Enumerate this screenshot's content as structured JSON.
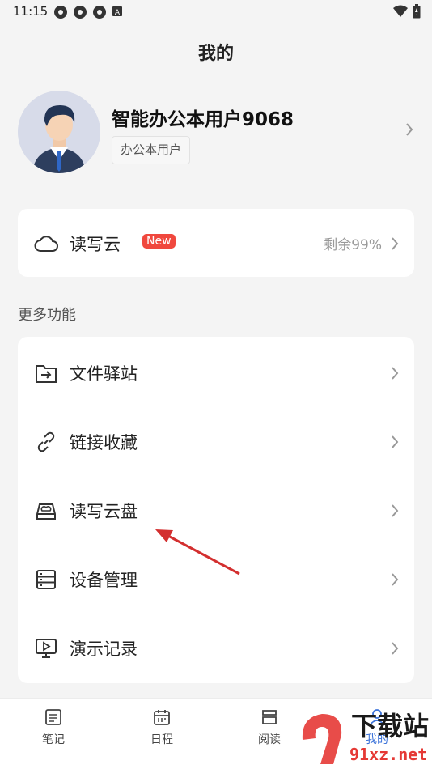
{
  "status_bar": {
    "time": "11:15",
    "notif_icons": [
      "aperture-icon",
      "aperture-icon",
      "aperture-icon",
      "a-box-icon"
    ],
    "right_icons": [
      "wifi-icon",
      "battery-icon"
    ]
  },
  "page": {
    "title": "我的"
  },
  "profile": {
    "name": "智能办公本用户9068",
    "tag": "办公本用户"
  },
  "cloud": {
    "label": "读写云",
    "badge": "New",
    "remaining": "剩余99%"
  },
  "section": {
    "label": "更多功能"
  },
  "features": [
    {
      "label": "文件驿站",
      "icon": "folder-transfer-icon"
    },
    {
      "label": "链接收藏",
      "icon": "link-icon"
    },
    {
      "label": "读写云盘",
      "icon": "cloud-disk-icon"
    },
    {
      "label": "设备管理",
      "icon": "device-manage-icon"
    },
    {
      "label": "演示记录",
      "icon": "presentation-icon"
    }
  ],
  "tabs": [
    {
      "label": "笔记",
      "icon": "note-icon",
      "active": false
    },
    {
      "label": "日程",
      "icon": "calendar-icon",
      "active": false
    },
    {
      "label": "阅读",
      "icon": "read-icon",
      "active": false
    },
    {
      "label": "我的",
      "icon": "person-icon",
      "active": true
    }
  ],
  "watermark": {
    "line1": "下载站",
    "line2": "91xz.net"
  },
  "colors": {
    "accent": "#3b72d9",
    "badge": "#f0483e",
    "arrow": "#d32f2f",
    "background": "#f4f4f4"
  }
}
